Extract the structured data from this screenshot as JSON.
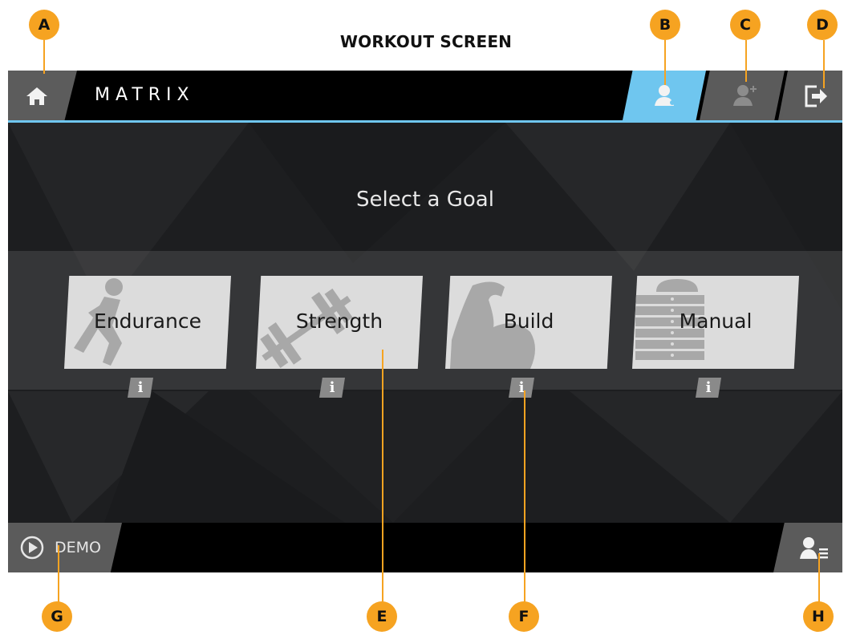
{
  "page": {
    "title": "WORKOUT SCREEN"
  },
  "header": {
    "logo": "MATRIX",
    "icons": {
      "home": "home-icon",
      "profile": "user-profile-icon",
      "add_user": "add-user-icon",
      "logout": "logout-icon"
    },
    "accent_color": "#6fc6ef"
  },
  "main": {
    "heading": "Select a Goal",
    "goals": [
      {
        "label": "Endurance",
        "icon": "runner-icon",
        "info": "i"
      },
      {
        "label": "Strength",
        "icon": "dumbbell-icon",
        "info": "i"
      },
      {
        "label": "Build",
        "icon": "flexed-arm-icon",
        "info": "i"
      },
      {
        "label": "Manual",
        "icon": "stack-icon",
        "info": "i"
      }
    ]
  },
  "footer": {
    "demo_label": "DEMO",
    "icons": {
      "demo": "play-icon",
      "user_list": "user-list-icon"
    }
  },
  "callouts": {
    "A": "A",
    "B": "B",
    "C": "C",
    "D": "D",
    "E": "E",
    "F": "F",
    "G": "G",
    "H": "H",
    "color": "#f6a321"
  }
}
